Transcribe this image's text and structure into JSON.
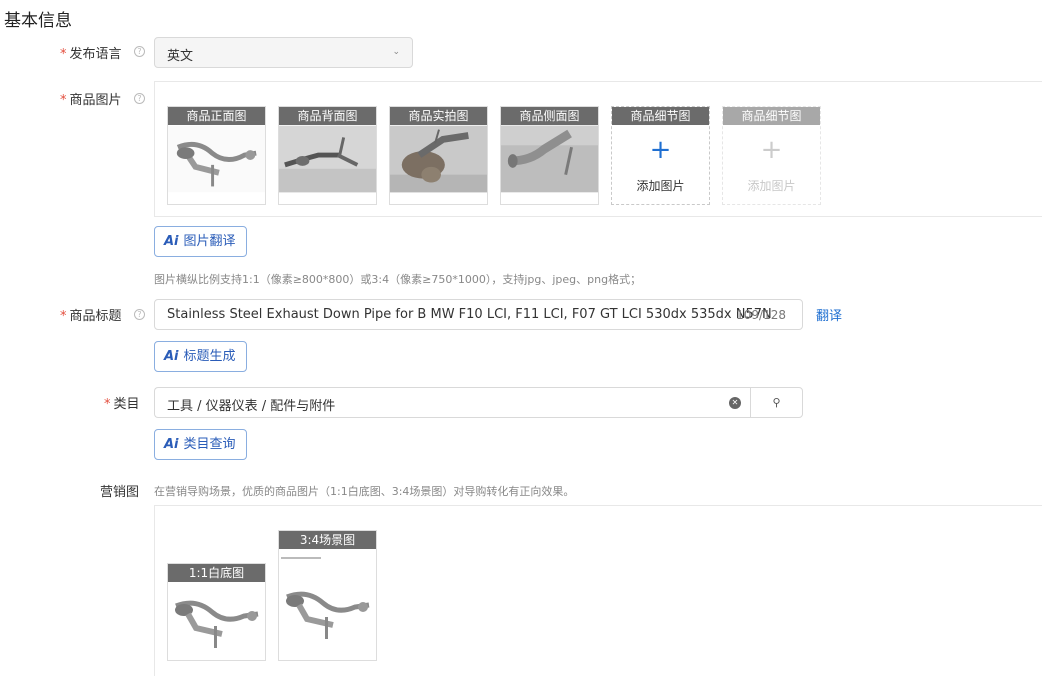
{
  "section_title": "基本信息",
  "language": {
    "label": "发布语言",
    "value": "英文"
  },
  "images": {
    "label": "商品图片",
    "slots": [
      {
        "caption": "商品正面图",
        "state": "filled"
      },
      {
        "caption": "商品背面图",
        "state": "filled"
      },
      {
        "caption": "商品实拍图",
        "state": "filled"
      },
      {
        "caption": "商品侧面图",
        "state": "filled"
      },
      {
        "caption": "商品细节图",
        "state": "add",
        "add_label": "添加图片"
      },
      {
        "caption": "商品细节图",
        "state": "disabled",
        "add_label": "添加图片"
      }
    ],
    "ai_button": "图片翻译",
    "hint": "图片横纵比例支持1:1（像素≥800*800）或3:4（像素≥750*1000），支持jpg、jpeg、png格式；"
  },
  "title": {
    "label": "商品标题",
    "value": "Stainless Steel Exhaust Down Pipe for B MW F10 LCI, F11 LCI, F07 GT LCI 530dx 535dx N57N",
    "count": "109/128",
    "translate_link": "翻译",
    "ai_button": "标题生成"
  },
  "category": {
    "label": "类目",
    "value": "工具 / 仪器仪表 / 配件与附件",
    "ai_button": "类目查询"
  },
  "marketing": {
    "label": "营销图",
    "hint": "在营销导购场景，优质的商品图片（1:1白底图、3:4场景图）对导购转化有正向效果。",
    "images": [
      {
        "caption": "1:1白底图"
      },
      {
        "caption": "3:4场景图"
      }
    ]
  },
  "icons": {
    "help": "question-circle-icon",
    "dropdown": "chevron-down-icon",
    "ai": "ai-icon",
    "plus": "plus-icon",
    "clear": "clear-circle-icon",
    "search": "search-icon"
  },
  "colors": {
    "required": "#e34d3d",
    "link": "#1f6fd1",
    "ai_border": "#8aaee0",
    "caption_bg": "#6b6b6b"
  }
}
